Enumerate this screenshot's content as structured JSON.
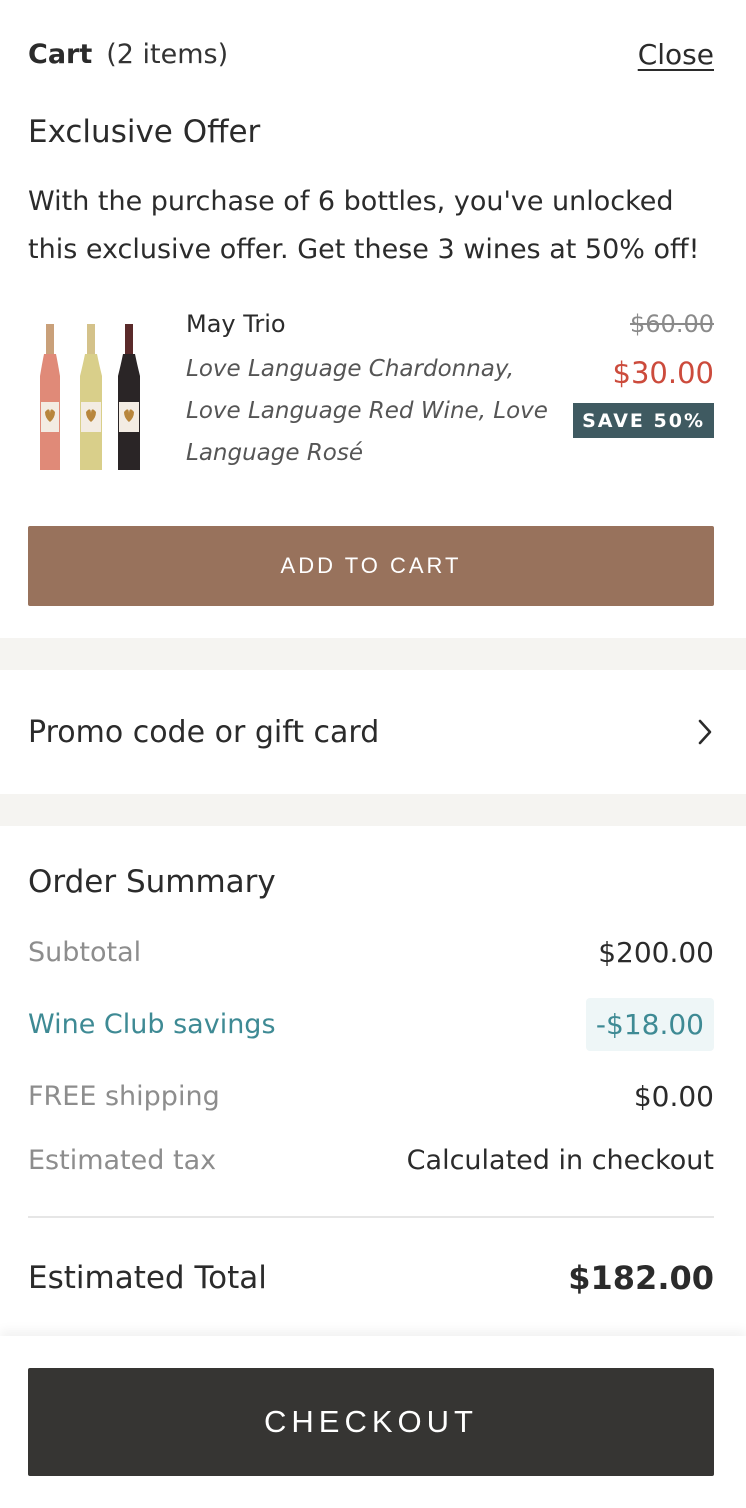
{
  "header": {
    "title": "Cart",
    "item_count": "(2 items)",
    "close_label": "Close"
  },
  "offer": {
    "heading": "Exclusive Offer",
    "description": "With the purchase of 6 bottles, you've unlocked this exclusive offer. Get these 3 wines at 50% off!",
    "product": {
      "name": "May Trio",
      "description": "Love Language Chardonnay, Love Language Red Wine, Love Language Rosé",
      "original_price": "$60.00",
      "sale_price": "$30.00",
      "badge": "SAVE 50%"
    },
    "add_to_cart_label": "ADD TO CART"
  },
  "promo": {
    "label": "Promo code or gift card",
    "icon": "chevron-right-icon"
  },
  "summary": {
    "title": "Order Summary",
    "subtotal_label": "Subtotal",
    "subtotal_value": "$200.00",
    "savings_label": "Wine Club savings",
    "savings_value": "-$18.00",
    "shipping_label": "FREE shipping",
    "shipping_value": "$0.00",
    "tax_label": "Estimated tax",
    "tax_value": "Calculated in checkout",
    "total_label": "Estimated Total",
    "total_value": "$182.00"
  },
  "checkout_label": "CHECKOUT",
  "colors": {
    "add_to_cart_bg": "#98725c",
    "sale_price": "#cc4b3c",
    "badge_bg": "#3f5a61",
    "savings": "#3e8a94",
    "checkout_bg": "#363533"
  }
}
